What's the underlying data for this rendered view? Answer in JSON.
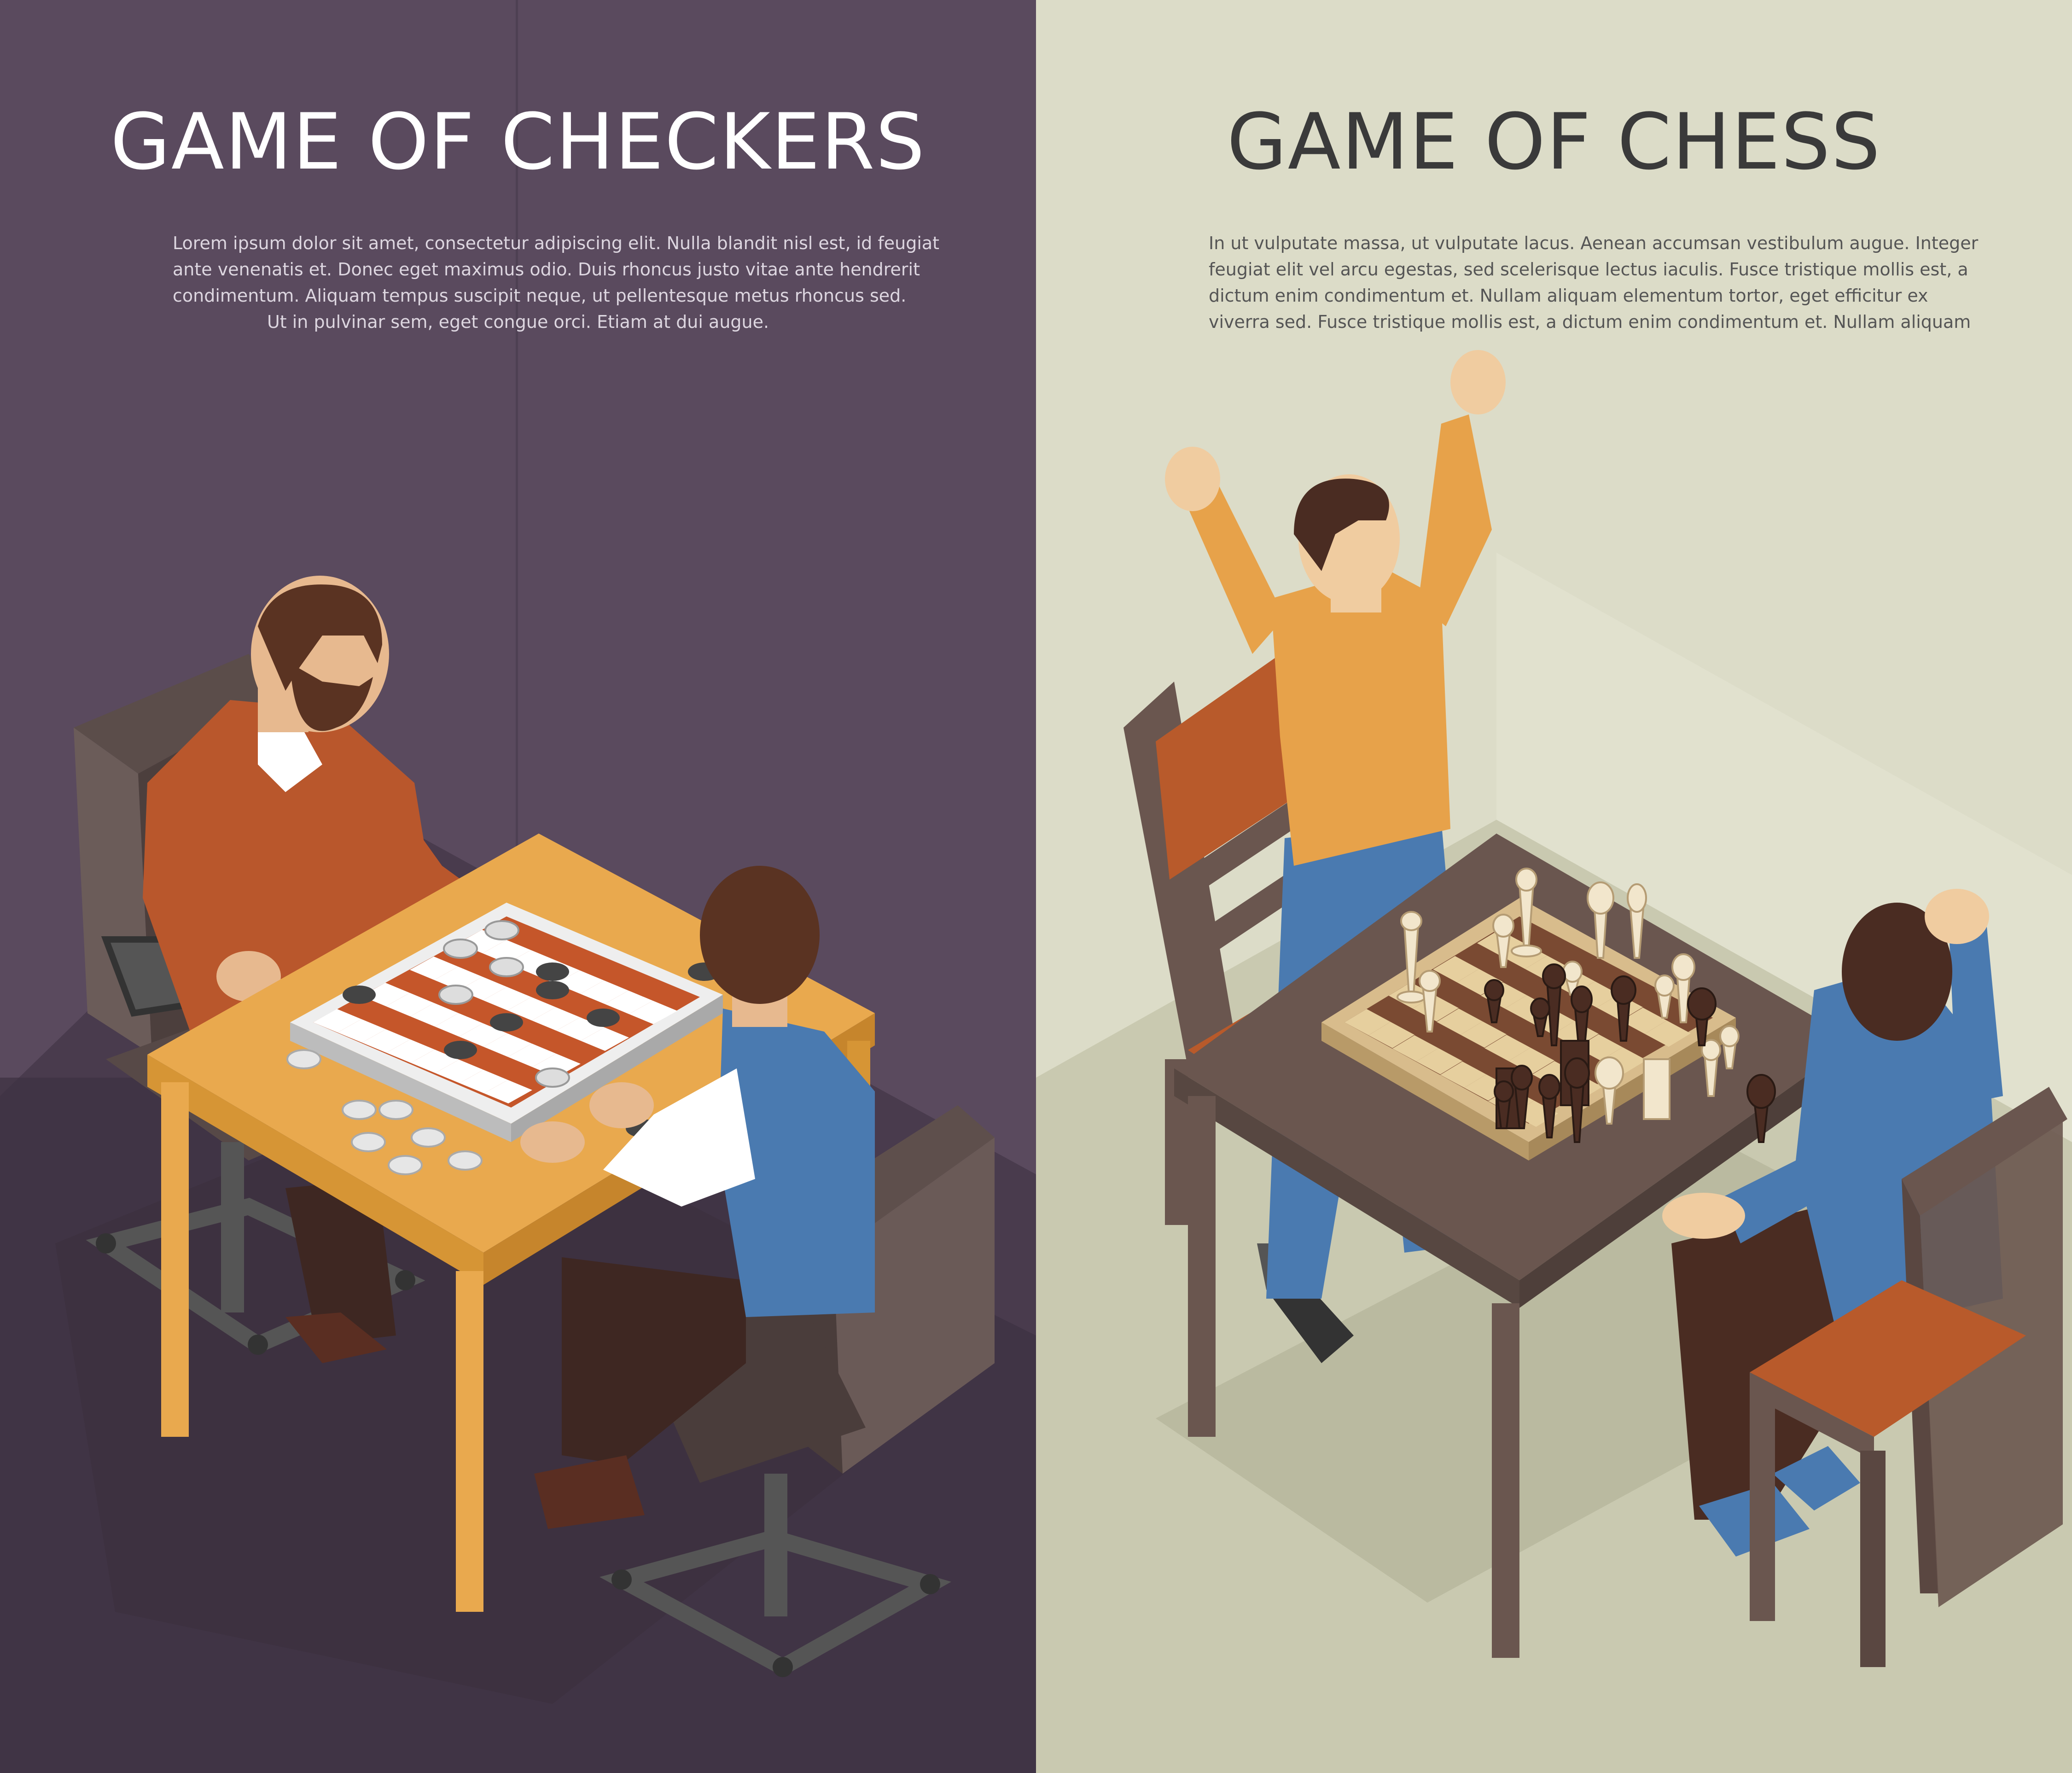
{
  "banners": [
    {
      "title": "GAME OF CHECKERS",
      "text_lines": [
        "Lorem ipsum dolor sit amet, consectetur adipiscing elit. Nulla blandit nisl est, id feugiat",
        "ante venenatis et. Donec eget maximus odio. Duis rhoncus justo vitae ante hendrerit",
        "condimentum. Aliquam tempus suscipit neque, ut pellentesque metus rhoncus sed.",
        "Ut in pulvinar sem, eget congue orci. Etiam at dui augue."
      ],
      "background_color": "#5a4a5e"
    },
    {
      "title": "GAME OF CHESS",
      "text_lines": [
        "In ut vulputate massa, ut vulputate lacus. Aenean accumsan vestibulum augue. Integer",
        "feugiat elit vel arcu egestas, sed scelerisque lectus iaculis. Fusce tristique mollis est, a",
        "dictum enim condimentum et. Nullam aliquam elementum tortor, eget efficitur ex",
        "viverra sed. Fusce tristique mollis est, a dictum enim condimentum et. Nullam aliquam"
      ],
      "background_color": "#dcdcc8"
    }
  ]
}
